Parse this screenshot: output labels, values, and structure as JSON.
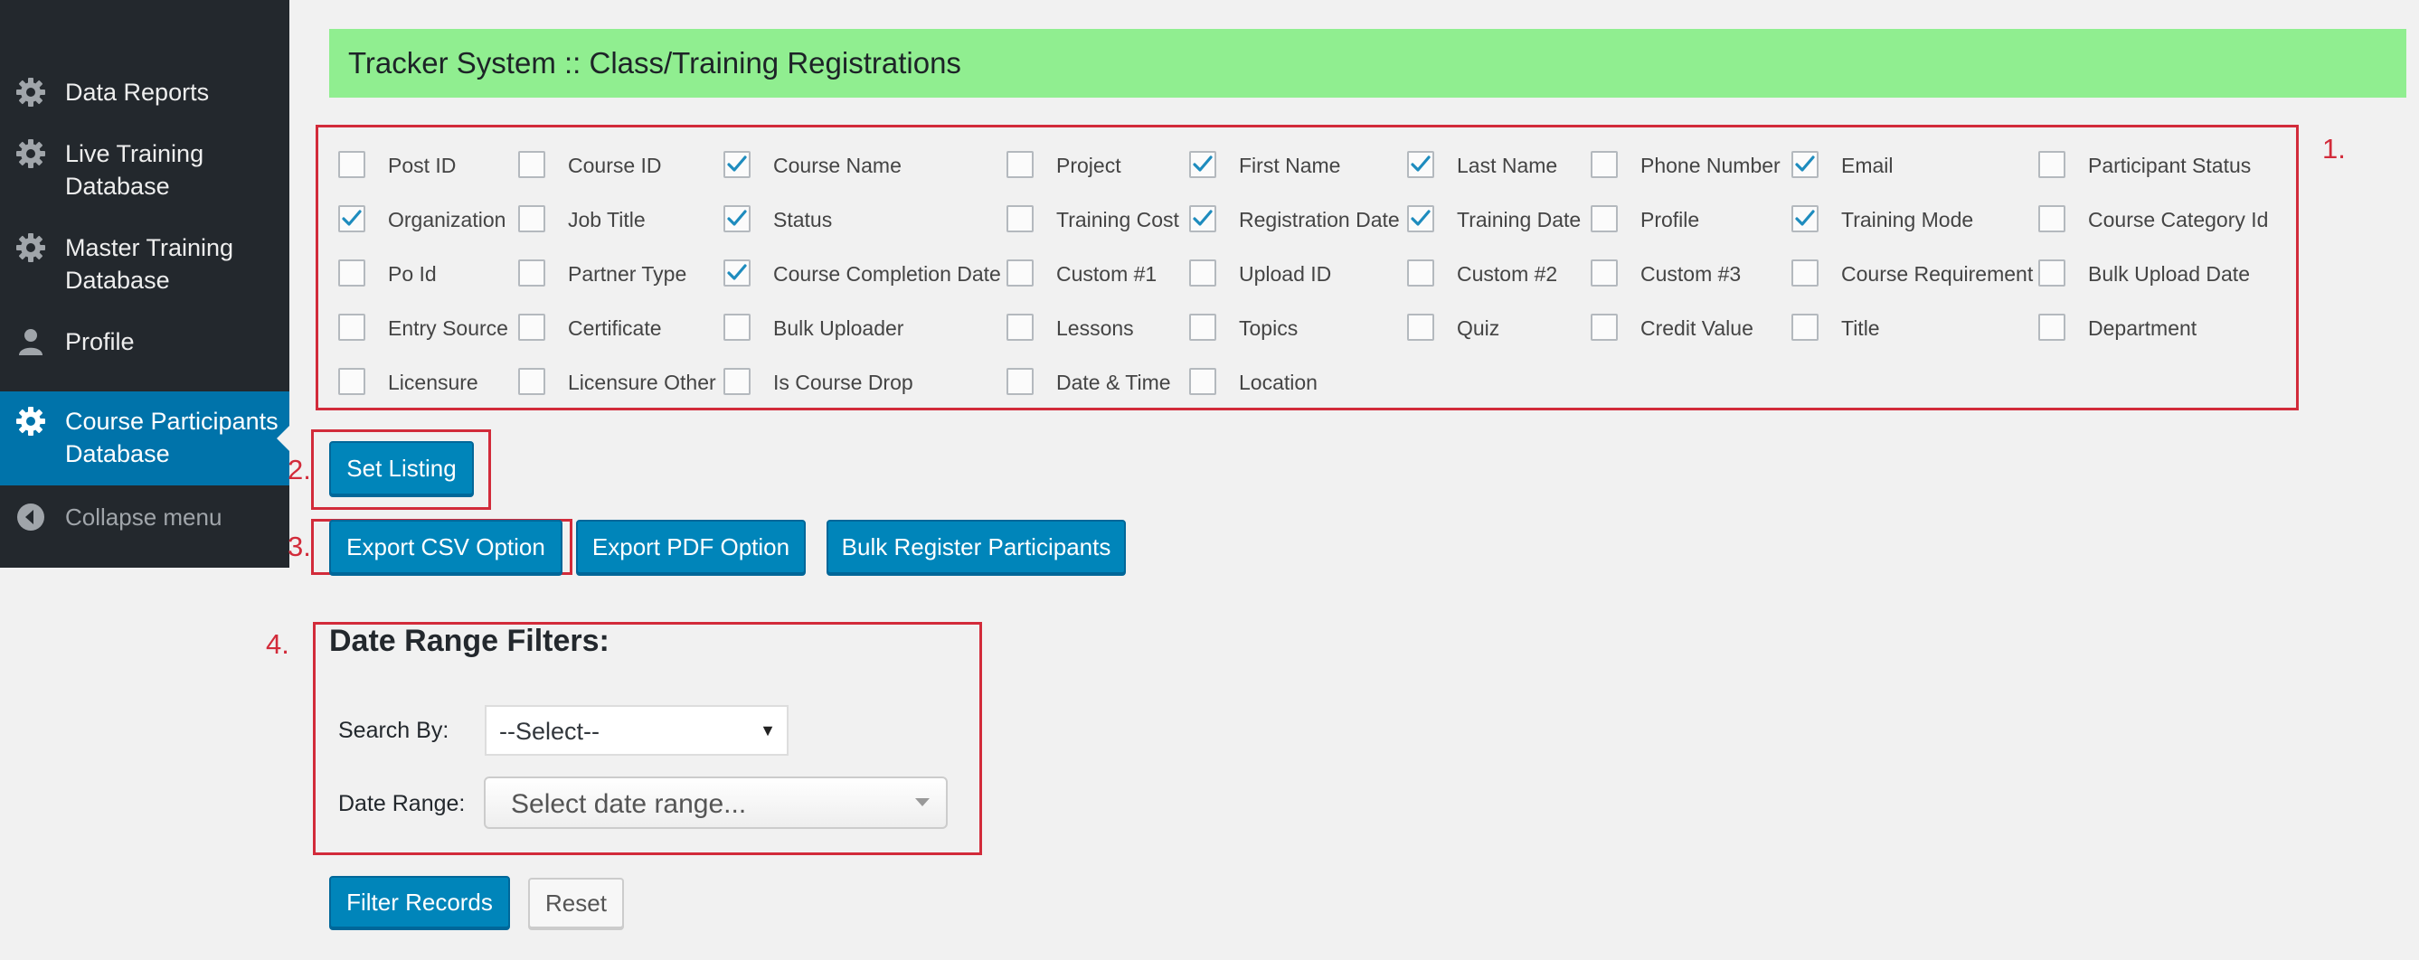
{
  "sidebar": {
    "items": [
      {
        "label": "Data Reports",
        "icon": "gear-icon"
      },
      {
        "label": "Live Training Database",
        "icon": "gear-icon"
      },
      {
        "label": "Master Training Database",
        "icon": "gear-icon"
      },
      {
        "label": "Profile",
        "icon": "user-icon"
      },
      {
        "label": "Course Participants Database",
        "icon": "gear-icon",
        "active": true
      },
      {
        "label": "Collapse menu",
        "icon": "collapse-arrow-icon"
      }
    ]
  },
  "header": {
    "title": "Tracker System :: Class/Training Registrations"
  },
  "annotations": [
    "1.",
    "2.",
    "3.",
    "4."
  ],
  "columns": [
    {
      "label": "Post ID",
      "checked": false
    },
    {
      "label": "Course ID",
      "checked": false
    },
    {
      "label": "Course Name",
      "checked": true
    },
    {
      "label": "Project",
      "checked": false
    },
    {
      "label": "First Name",
      "checked": true
    },
    {
      "label": "Last Name",
      "checked": true
    },
    {
      "label": "Phone Number",
      "checked": false
    },
    {
      "label": "Email",
      "checked": true
    },
    {
      "label": "Participant Status",
      "checked": false
    },
    {
      "label": "Organization",
      "checked": true
    },
    {
      "label": "Job Title",
      "checked": false
    },
    {
      "label": "Status",
      "checked": true
    },
    {
      "label": "Training Cost",
      "checked": false
    },
    {
      "label": "Registration Date",
      "checked": true
    },
    {
      "label": "Training Date",
      "checked": true
    },
    {
      "label": "Profile",
      "checked": false
    },
    {
      "label": "Training Mode",
      "checked": true
    },
    {
      "label": "Course Category Id",
      "checked": false
    },
    {
      "label": "Po Id",
      "checked": false
    },
    {
      "label": "Partner Type",
      "checked": false
    },
    {
      "label": "Course Completion Date",
      "checked": true
    },
    {
      "label": "Custom #1",
      "checked": false
    },
    {
      "label": "Upload ID",
      "checked": false
    },
    {
      "label": "Custom #2",
      "checked": false
    },
    {
      "label": "Custom #3",
      "checked": false
    },
    {
      "label": "Course Requirement",
      "checked": false
    },
    {
      "label": "Bulk Upload Date",
      "checked": false
    },
    {
      "label": "Entry Source",
      "checked": false
    },
    {
      "label": "Certificate",
      "checked": false
    },
    {
      "label": "Bulk Uploader",
      "checked": false
    },
    {
      "label": "Lessons",
      "checked": false
    },
    {
      "label": "Topics",
      "checked": false
    },
    {
      "label": "Quiz",
      "checked": false
    },
    {
      "label": "Credit Value",
      "checked": false
    },
    {
      "label": "Title",
      "checked": false
    },
    {
      "label": "Department",
      "checked": false
    },
    {
      "label": "Licensure",
      "checked": false
    },
    {
      "label": "Licensure Other",
      "checked": false
    },
    {
      "label": "Is Course Drop",
      "checked": false
    },
    {
      "label": "Date & Time",
      "checked": false
    },
    {
      "label": "Location",
      "checked": false
    }
  ],
  "buttons": {
    "set_listing": "Set Listing",
    "export_csv": "Export CSV Option",
    "export_pdf": "Export PDF Option",
    "bulk_register": "Bulk Register Participants",
    "filter_records": "Filter Records",
    "reset": "Reset"
  },
  "filters": {
    "heading": "Date Range Filters:",
    "search_by_label": "Search By:",
    "search_by_value": "--Select--",
    "date_range_label": "Date Range:",
    "date_range_placeholder": "Select date range..."
  },
  "colors": {
    "header_bg": "#90ee90",
    "sidebar_bg": "#23282d",
    "active_menu_bg": "#0073aa",
    "primary_button": "#0085ba",
    "annotation_red": "#d22b3a"
  }
}
